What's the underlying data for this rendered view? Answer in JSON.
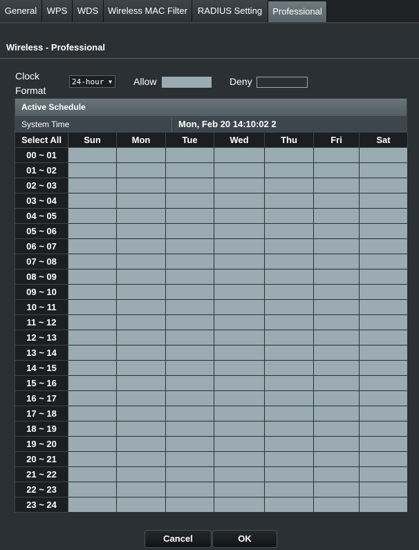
{
  "tabs": [
    {
      "label": "General"
    },
    {
      "label": "WPS"
    },
    {
      "label": "WDS"
    },
    {
      "label": "Wireless MAC Filter"
    },
    {
      "label": "RADIUS Setting"
    },
    {
      "label": "Professional"
    }
  ],
  "page": {
    "title": "Wireless - Professional"
  },
  "clock": {
    "label": "Clock Format",
    "selected": "24-hour"
  },
  "legend": {
    "allow_label": "Allow",
    "deny_label": "Deny",
    "allow_color": "#9aabb2",
    "deny_color": "#2b3034"
  },
  "schedule": {
    "header": "Active Schedule",
    "system_time_label": "System Time",
    "system_time_value": "Mon, Feb 20 14:10:02 2",
    "select_all": "Select All",
    "days": [
      "Sun",
      "Mon",
      "Tue",
      "Wed",
      "Thu",
      "Fri",
      "Sat"
    ],
    "hours": [
      "00 ~ 01",
      "01 ~ 02",
      "02 ~ 03",
      "03 ~ 04",
      "04 ~ 05",
      "05 ~ 06",
      "06 ~ 07",
      "07 ~ 08",
      "08 ~ 09",
      "09 ~ 10",
      "10 ~ 11",
      "11 ~ 12",
      "12 ~ 13",
      "13 ~ 14",
      "14 ~ 15",
      "15 ~ 16",
      "16 ~ 17",
      "17 ~ 18",
      "18 ~ 19",
      "19 ~ 20",
      "20 ~ 21",
      "21 ~ 22",
      "22 ~ 23",
      "23 ~ 24"
    ]
  },
  "buttons": {
    "cancel": "Cancel",
    "ok": "OK"
  }
}
